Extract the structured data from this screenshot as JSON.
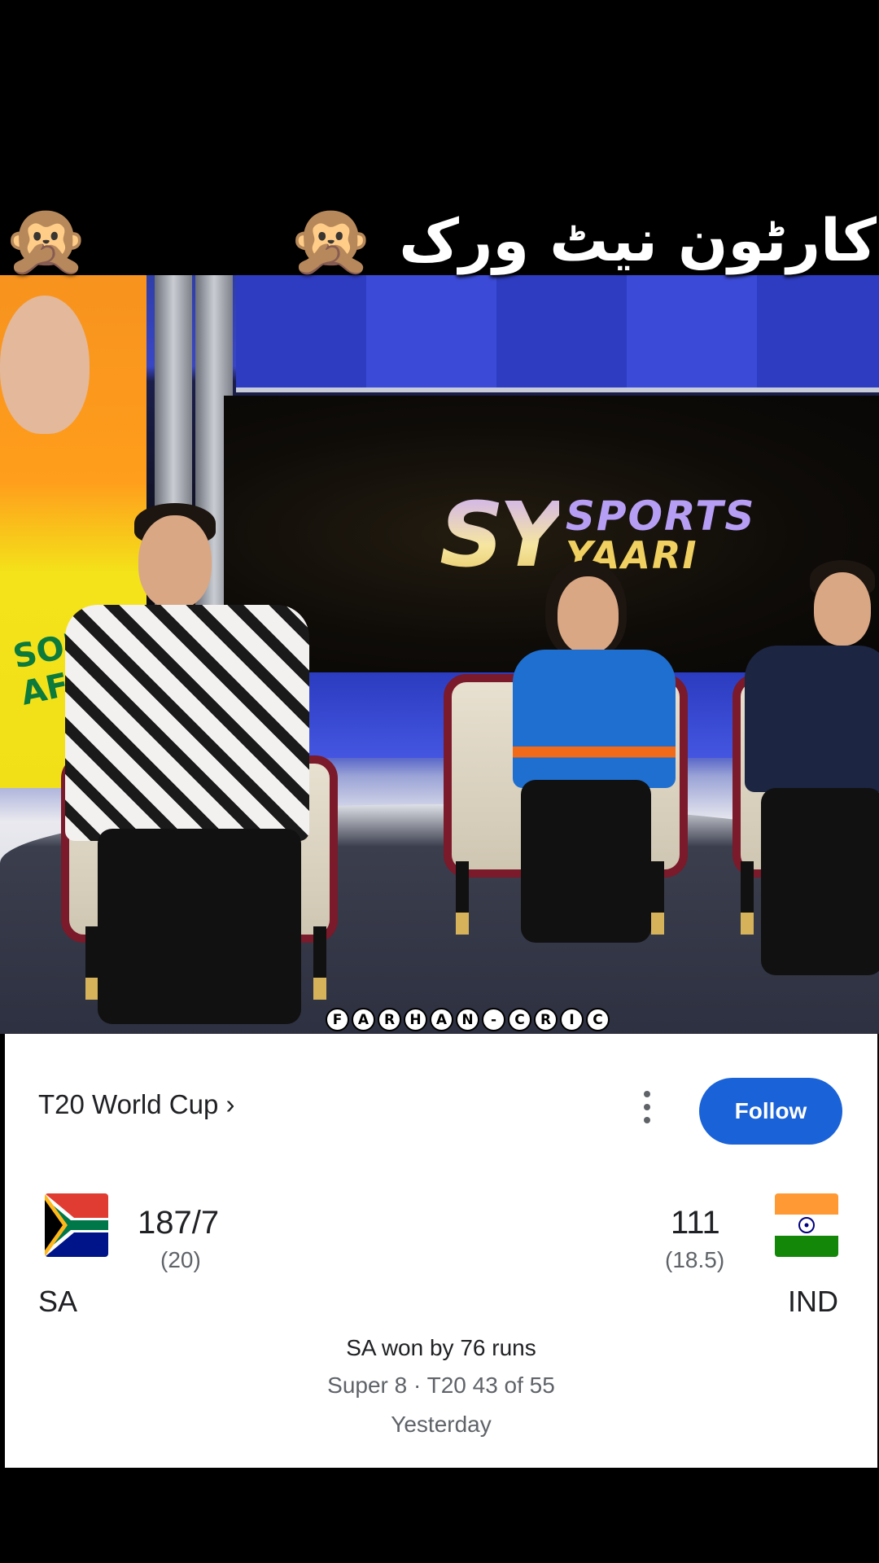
{
  "caption": {
    "emoji": [
      "🙊",
      "😂",
      "😂",
      "🙊"
    ],
    "text": "کارٹون نیٹ ورک"
  },
  "scene": {
    "logo_letters": "SY",
    "logo_word1": "SPORTS",
    "logo_word2": "YAARI",
    "poster_text": "SOUTH AFR",
    "watermark": [
      "F",
      "A",
      "R",
      "H",
      "A",
      "N",
      "-",
      "C",
      "R",
      "I",
      "C"
    ]
  },
  "scorecard": {
    "tournament": "T20 World Cup ›",
    "follow_label": "Follow",
    "home": {
      "team": "SA",
      "score": "187/7",
      "overs": "(20)"
    },
    "away": {
      "team": "IND",
      "score": "111",
      "overs": "(18.5)"
    },
    "result": "SA won by 76 runs",
    "stage": "Super 8 · T20 43 of 55",
    "when": "Yesterday"
  },
  "colors": {
    "follow_button": "#1a62d8",
    "card_background": "#ffffff"
  }
}
